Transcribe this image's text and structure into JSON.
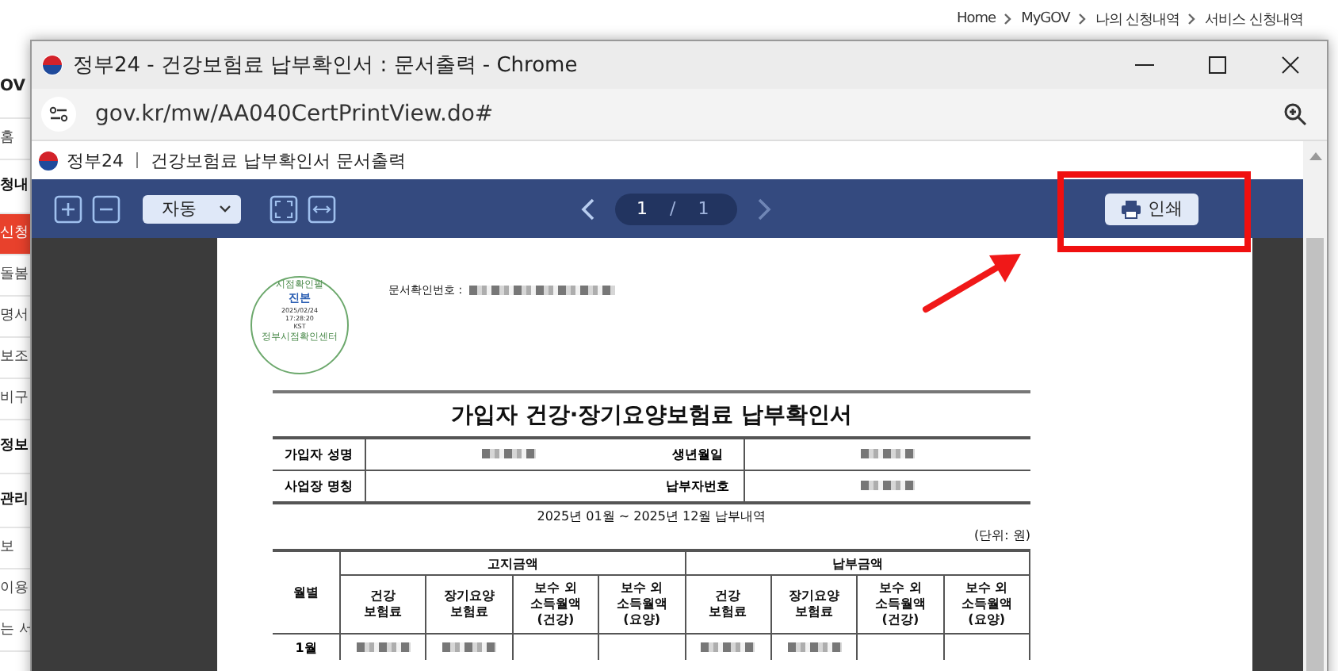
{
  "background_page": {
    "breadcrumb": [
      "Home",
      "MyGOV",
      "나의 신청내역",
      "서비스 신청내역"
    ],
    "sidebar_items": [
      {
        "label": "OV",
        "kind": "brand",
        "selected": false
      },
      {
        "label": "홈",
        "kind": "link",
        "selected": false
      },
      {
        "label": "청내",
        "kind": "heading",
        "selected": false
      },
      {
        "label": "신청",
        "kind": "link",
        "selected": true
      },
      {
        "label": "돌봄",
        "kind": "link",
        "selected": false
      },
      {
        "label": "명서",
        "kind": "link",
        "selected": false
      },
      {
        "label": "보조",
        "kind": "link",
        "selected": false
      },
      {
        "label": "비구",
        "kind": "link",
        "selected": false
      },
      {
        "label": "정보",
        "kind": "heading",
        "selected": false
      },
      {
        "label": "관리",
        "kind": "heading",
        "selected": false
      },
      {
        "label": "보",
        "kind": "link",
        "selected": false
      },
      {
        "label": "이용",
        "kind": "link",
        "selected": false
      },
      {
        "label": "는 서",
        "kind": "link",
        "selected": false
      }
    ]
  },
  "window": {
    "title": "정부24 - 건강보험료 납부확인서 : 문서출력 - Chrome",
    "url": "gov.kr/mw/AA040CertPrintView.do#"
  },
  "page_header": {
    "site": "정부24",
    "title": "건강보험료 납부확인서 문서출력"
  },
  "toolbar": {
    "zoom_mode": "자동",
    "page": "1",
    "page_separator": "/",
    "page_count": "1",
    "print_button": "인쇄"
  },
  "document": {
    "stamp": {
      "top": "시점확인필",
      "center": "진본",
      "date": "2025/02/24",
      "time": "17:28:20",
      "zone": "KST",
      "bottom": "정부시점확인센터"
    },
    "confirmation_label": "문서확인번호 :",
    "confirmation_redacted": true,
    "title": "가입자 건강·장기요양보험료 납부확인서",
    "info_rows": [
      [
        {
          "kind": "label",
          "text": "가입자 성명"
        },
        {
          "kind": "redacted"
        },
        {
          "kind": "label",
          "text": "생년월일"
        },
        {
          "kind": "redacted"
        }
      ],
      [
        {
          "kind": "label",
          "text": "사업장 명칭"
        },
        {
          "kind": "empty"
        },
        {
          "kind": "label",
          "text": "납부자번호"
        },
        {
          "kind": "redacted"
        }
      ]
    ],
    "period": "2025년 01월 ~ 2025년 12월 납부내역",
    "unit": "(단위: 원)",
    "table": {
      "month_header": "월별",
      "groups": [
        "고지금액",
        "납부금액"
      ],
      "columns": [
        "건강\n보험료",
        "장기요양\n보험료",
        "보수 외\n소득월액\n(건강)",
        "보수 외\n소득월액\n(요양)",
        "건강\n보험료",
        "장기요양\n보험료",
        "보수 외\n소득월액\n(건강)",
        "보수 외\n소득월액\n(요양)"
      ],
      "rows": [
        {
          "month": "1월",
          "redacted": [
            true,
            true,
            false,
            false,
            true,
            true,
            false,
            false
          ]
        }
      ]
    }
  },
  "annotation": {
    "highlight_box": true,
    "arrow": true
  }
}
